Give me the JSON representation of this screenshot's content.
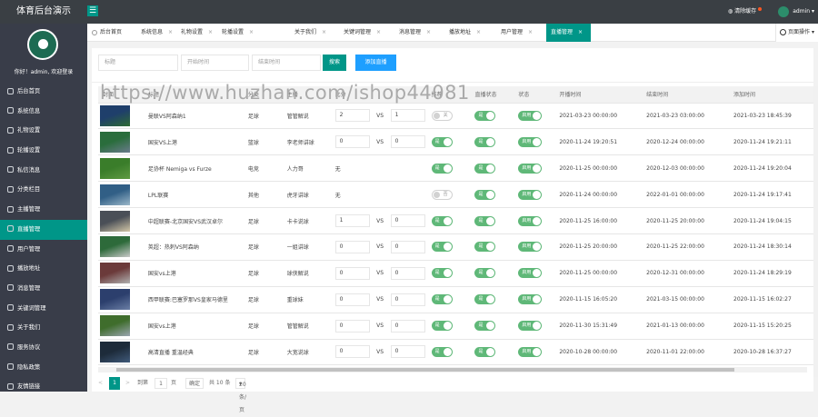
{
  "app": {
    "title": "体育后台演示"
  },
  "topbar": {
    "clear_cache": "清除缓存",
    "user": "admin"
  },
  "sidebar": {
    "welcome": "你好！admin, 欢迎登录",
    "items": [
      {
        "label": "后台首页",
        "icon": "home-icon"
      },
      {
        "label": "系统信息",
        "icon": "info-icon"
      },
      {
        "label": "礼物设置",
        "icon": "gift-icon"
      },
      {
        "label": "轮播设置",
        "icon": "slides-icon"
      },
      {
        "label": "私信消息",
        "icon": "message-icon"
      },
      {
        "label": "分类栏目",
        "icon": "category-icon"
      },
      {
        "label": "主播管理",
        "icon": "anchor-icon"
      },
      {
        "label": "直播管理",
        "icon": "live-icon"
      },
      {
        "label": "用户管理",
        "icon": "user-icon"
      },
      {
        "label": "播放地址",
        "icon": "link-icon"
      },
      {
        "label": "消息管理",
        "icon": "bell-icon"
      },
      {
        "label": "关键词管理",
        "icon": "key-icon"
      },
      {
        "label": "关于我们",
        "icon": "about-icon"
      },
      {
        "label": "服务协议",
        "icon": "agreement-icon"
      },
      {
        "label": "隐私政策",
        "icon": "privacy-icon"
      },
      {
        "label": "友情链接",
        "icon": "friend-link-icon"
      }
    ]
  },
  "tabs": [
    {
      "label": "后台首页"
    },
    {
      "label": "系统信息"
    },
    {
      "label": "礼物设置"
    },
    {
      "label": "轮播设置"
    },
    {
      "label": "关于我们"
    },
    {
      "label": "关键词管理"
    },
    {
      "label": "消息管理"
    },
    {
      "label": "播放地址"
    },
    {
      "label": "用户管理"
    },
    {
      "label": "直播管理"
    }
  ],
  "page_ops": "页面操作",
  "filter": {
    "title_placeholder": "标题",
    "start_placeholder": "开始时间",
    "end_placeholder": "结束时间",
    "search_label": "搜索",
    "add_label": "添加直播"
  },
  "watermark": "https://www.huzhan.com/ishop44081",
  "table": {
    "headers": [
      "封面",
      "标题",
      "分类",
      "主播",
      "比分",
      "",
      "",
      "推荐",
      "直播状态",
      "状态",
      "开播时间",
      "结束时间",
      "添加时间"
    ],
    "rows": [
      {
        "title": "曼联VS阿森纳1",
        "category": "足球",
        "anchor": "管管解说",
        "s1": "2",
        "s2": "1",
        "rec": "关",
        "rec_on": false,
        "live": "是",
        "state": "启用",
        "start": "2021-03-23 00:00:00",
        "end": "2021-03-23 03:00:00",
        "added": "2021-03-23 18:45:39"
      },
      {
        "title": "国安VS上港",
        "category": "篮球",
        "anchor": "李老师讲球",
        "s1": "0",
        "s2": "0",
        "rec": "是",
        "rec_on": true,
        "live": "是",
        "state": "启用",
        "start": "2020-11-24 19:20:51",
        "end": "2020-12-24 00:00:00",
        "added": "2020-11-24 19:21:11"
      },
      {
        "title": "足协杯 Nemiga vs Furze",
        "category": "电竞",
        "anchor": "人力哥",
        "s1": "",
        "s2": "",
        "note": "无",
        "rec": "是",
        "rec_on": true,
        "live": "是",
        "state": "启用",
        "start": "2020-11-25 00:00:00",
        "end": "2020-12-03 00:00:00",
        "added": "2020-11-24 19:20:04"
      },
      {
        "title": "LPL联赛",
        "category": "其他",
        "anchor": "虎牙讲球",
        "s1": "",
        "s2": "",
        "note": "无",
        "rec": "否",
        "rec_on": false,
        "live": "是",
        "state": "启用",
        "start": "2020-11-24 00:00:00",
        "end": "2022-01-01 00:00:00",
        "added": "2020-11-24 19:17:41"
      },
      {
        "title": "中超联赛-北京国安VS武汉卓尔",
        "category": "足球",
        "anchor": "卡卡说球",
        "s1": "1",
        "s2": "0",
        "rec": "是",
        "rec_on": true,
        "live": "是",
        "state": "启用",
        "start": "2020-11-25 16:00:00",
        "end": "2020-11-25 20:00:00",
        "added": "2020-11-24 19:04:15"
      },
      {
        "title": "英超：热刺VS阿森纳",
        "category": "足球",
        "anchor": "一姐讲球",
        "s1": "0",
        "s2": "0",
        "rec": "是",
        "rec_on": true,
        "live": "是",
        "state": "启用",
        "start": "2020-11-25 20:00:00",
        "end": "2020-11-25 22:00:00",
        "added": "2020-11-24 18:30:14"
      },
      {
        "title": "国安vs上港",
        "category": "足球",
        "anchor": "球侠解说",
        "s1": "0",
        "s2": "0",
        "rec": "是",
        "rec_on": true,
        "live": "是",
        "state": "启用",
        "start": "2020-11-25 00:00:00",
        "end": "2020-12-31 00:00:00",
        "added": "2020-11-24 18:29:19"
      },
      {
        "title": "西甲联赛:巴塞罗那VS皇家马德里",
        "category": "足球",
        "anchor": "重球妹",
        "s1": "0",
        "s2": "0",
        "rec": "是",
        "rec_on": true,
        "live": "是",
        "state": "启用",
        "start": "2020-11-15 16:05:20",
        "end": "2021-03-15 00:00:00",
        "added": "2020-11-15 16:02:27"
      },
      {
        "title": "国安vs上港",
        "category": "足球",
        "anchor": "管管解说",
        "s1": "0",
        "s2": "0",
        "rec": "是",
        "rec_on": true,
        "live": "是",
        "state": "启用",
        "start": "2020-11-30 15:31:49",
        "end": "2021-01-13 00:00:00",
        "added": "2020-11-15 15:20:25"
      },
      {
        "title": "高清直播 重温经典",
        "category": "足球",
        "anchor": "大宽说球",
        "s1": "0",
        "s2": "0",
        "rec": "是",
        "rec_on": true,
        "live": "是",
        "state": "启用",
        "start": "2020-10-28 00:00:00",
        "end": "2020-11-01 22:00:00",
        "added": "2020-10-28 16:37:27"
      }
    ],
    "vs": "VS"
  },
  "pager": {
    "prev": "<",
    "current": "1",
    "next": ">",
    "goto": "到第",
    "page_input": "1",
    "page_unit": "页",
    "confirm": "确定",
    "total": "共 10 条",
    "per_page": "20 条/页"
  },
  "colors": {
    "topbar": "#3a3f44",
    "sidebar": "#393d49",
    "accent": "#009688",
    "add": "#1e9fff",
    "switch_on": "#5fb878"
  }
}
